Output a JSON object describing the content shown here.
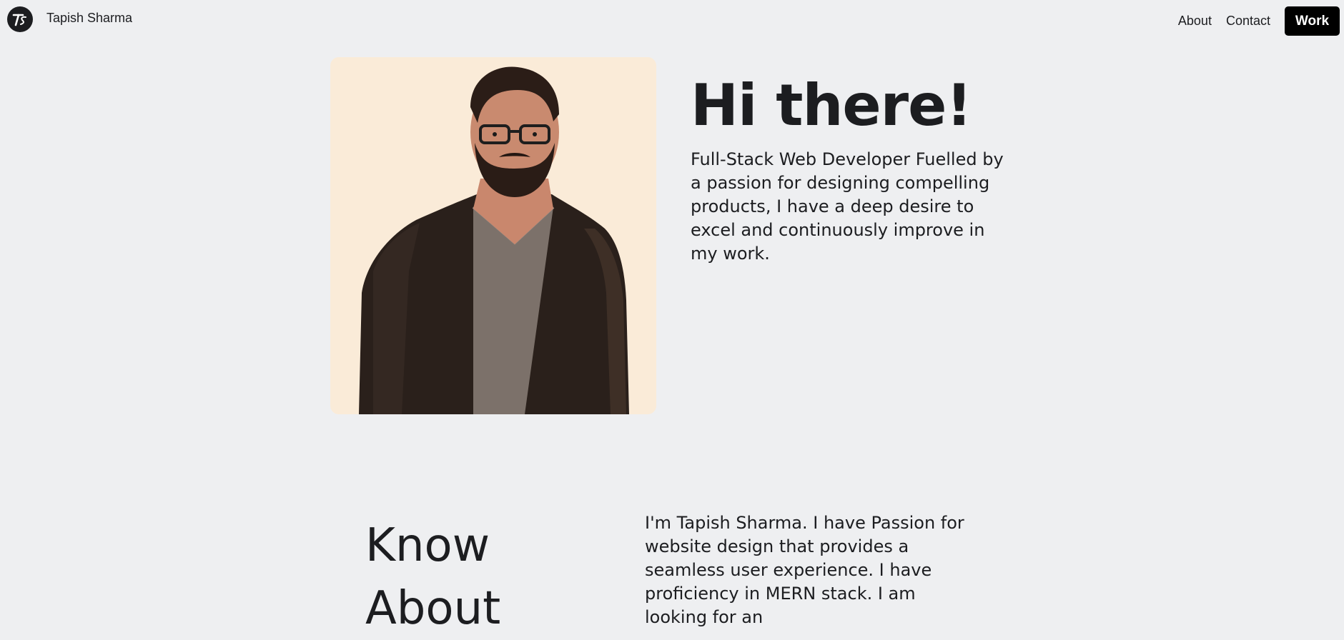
{
  "header": {
    "logo_icon": "ts-monogram-logo-icon",
    "site_name": "Tapish Sharma",
    "nav": {
      "about": "About",
      "contact": "Contact",
      "work": "Work"
    }
  },
  "hero": {
    "photo_icon": "profile-photo-icon",
    "photo_bg_color": "#faebd8",
    "title": "Hi there!",
    "description": "Full-Stack Web Developer Fuelled by a passion for designing compelling products, I have a deep desire to excel and continuously improve in my work."
  },
  "about": {
    "title": "Know About",
    "text": "I'm Tapish Sharma. I have Passion for website design that provides a seamless user experience. I have proficiency in MERN stack. I am looking for an"
  },
  "colors": {
    "background": "#eeeff1",
    "text": "#1c1d20",
    "button_bg": "#000000",
    "button_text": "#ffffff"
  }
}
